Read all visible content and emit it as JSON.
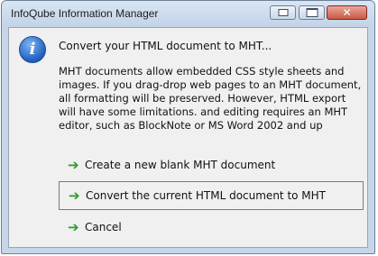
{
  "window": {
    "title": "InfoQube Information Manager",
    "minimize_icon": "minimize-icon",
    "maximize_icon": "maximize-icon",
    "close_icon": "close-icon",
    "close_glyph": "✕"
  },
  "dialog": {
    "info_icon": "info-icon",
    "info_glyph": "i",
    "heading": "Convert your HTML document to MHT...",
    "description": "MHT documents allow embedded CSS style sheets and images. If you drag-drop web pages to an MHT document, all formatting will be preserved. However, HTML export will have some limitations. and editing requires an MHT editor, such as BlockNote or MS Word 2002 and up",
    "commands": [
      {
        "label": "Create a new blank MHT document",
        "icon": "green-arrow-icon",
        "selected": false
      },
      {
        "label": "Convert the current HTML document to MHT",
        "icon": "green-arrow-icon",
        "selected": true
      },
      {
        "label": "Cancel",
        "icon": "green-arrow-icon",
        "selected": false
      }
    ],
    "arrow_glyph": "➔"
  },
  "colors": {
    "arrow": "#2e9a2a",
    "close_button": "#c85a44",
    "client_background": "#f0f0f0",
    "frame": "#c6d6e8"
  }
}
